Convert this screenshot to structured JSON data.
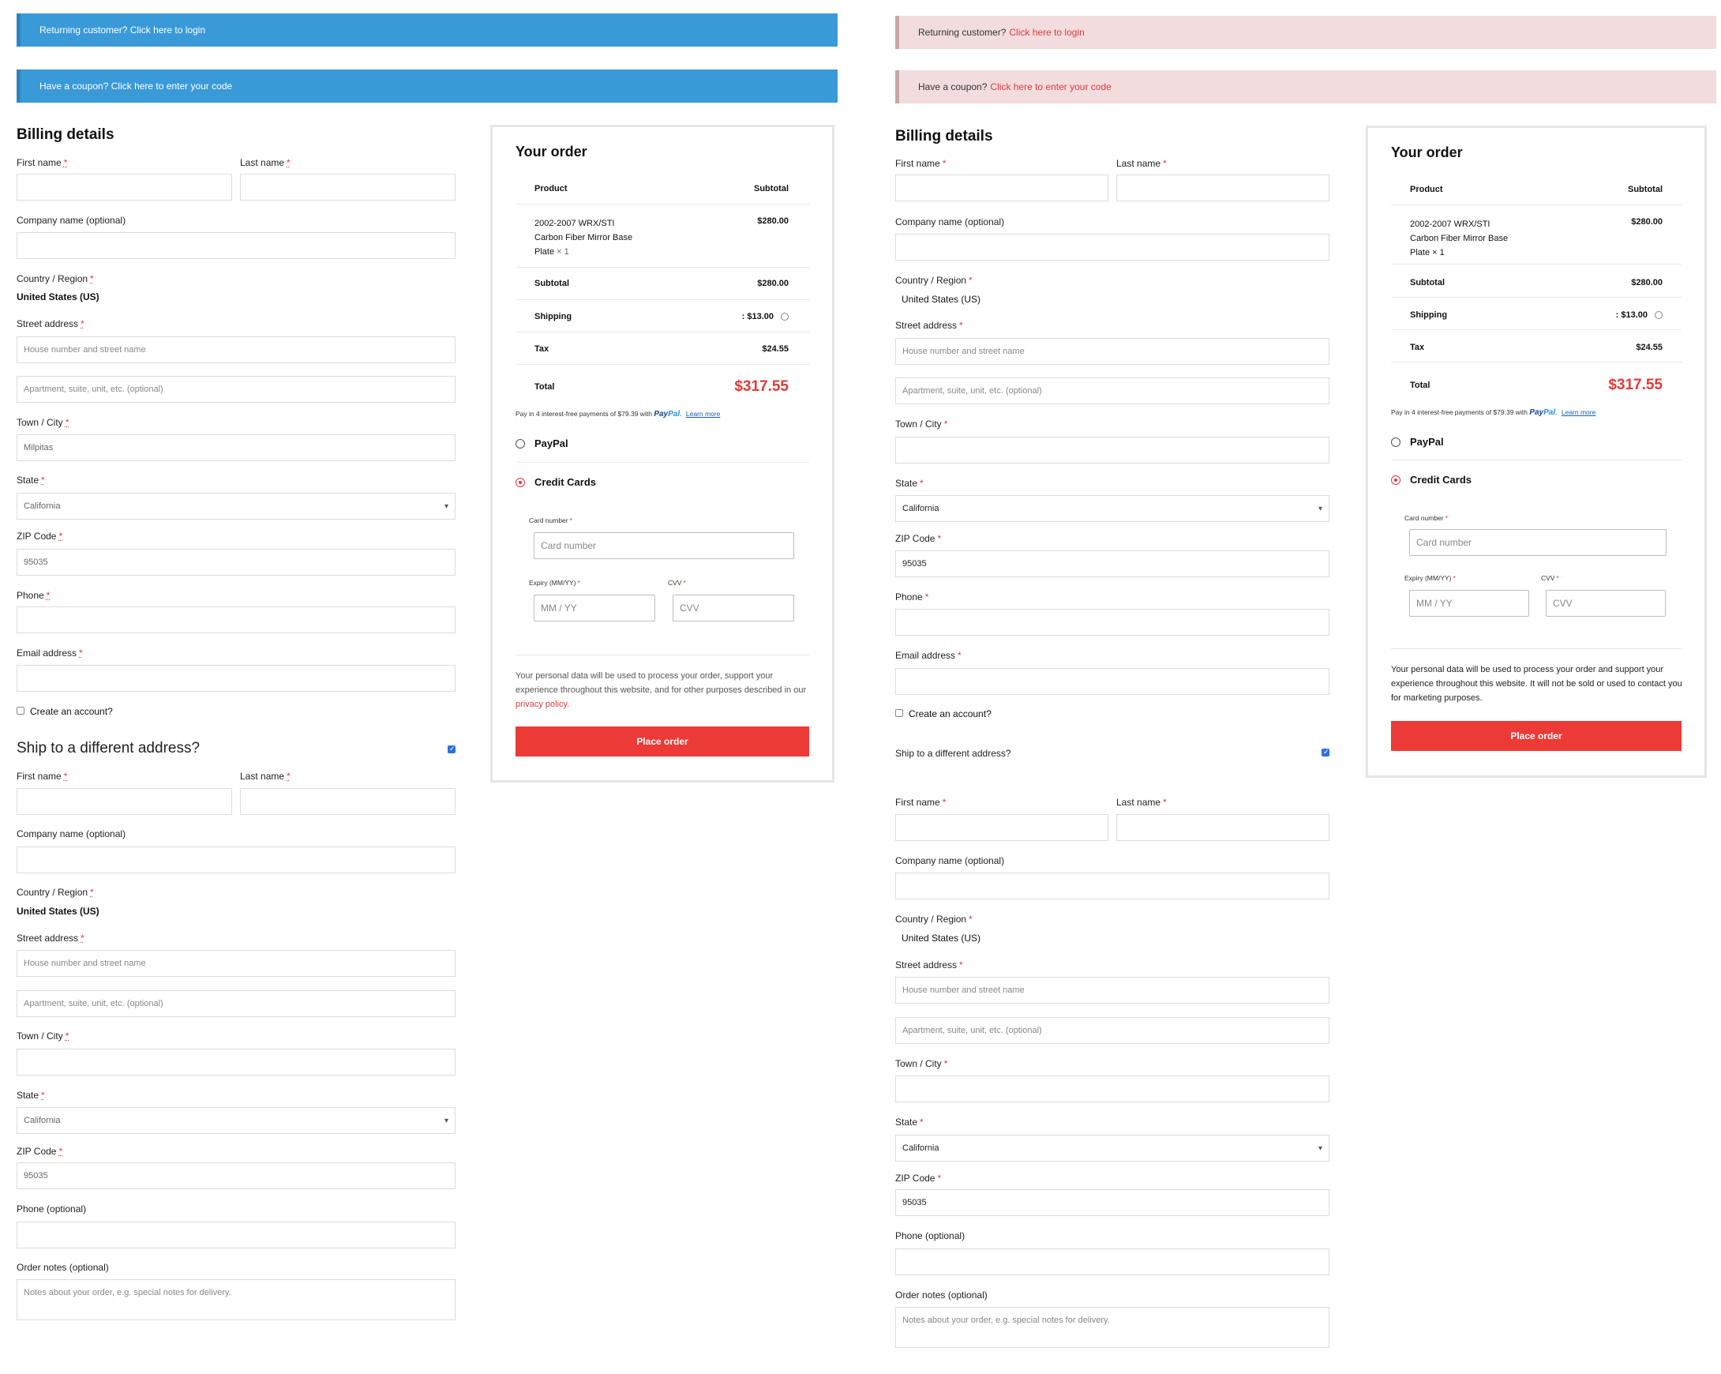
{
  "notices": {
    "returning": {
      "text": "Returning customer?",
      "link": "Click here to login"
    },
    "coupon": {
      "text": "Have a coupon?",
      "link": "Click here to enter your code"
    }
  },
  "billing": {
    "title": "Billing details",
    "first_name": "First name",
    "last_name": "Last name",
    "company": "Company name (optional)",
    "country": "Country / Region",
    "country_value": "United States (US)",
    "street": "Street address",
    "street_placeholder": "House number and street name",
    "apt_placeholder": "Apartment, suite, unit, etc. (optional)",
    "city": "Town / City",
    "city_value": "Milpitas",
    "state": "State",
    "state_value": "California",
    "zip": "ZIP Code",
    "zip_value": "95035",
    "phone": "Phone",
    "email": "Email address",
    "create_account": "Create an account?",
    "req": "*"
  },
  "shipping": {
    "title": "Ship to a different address?",
    "phone": "Phone (optional)",
    "order_notes": "Order notes (optional)",
    "notes_placeholder": "Notes about your order, e.g. special notes for delivery."
  },
  "order": {
    "title": "Your order",
    "col_product": "Product",
    "col_subtotal": "Subtotal",
    "item_line1": "2002-2007 WRX/STI",
    "item_line2": "Carbon Fiber Mirror Base",
    "item_line3": "Plate",
    "item_qty": "× 1",
    "item_price": "$280.00",
    "subtotal_label": "Subtotal",
    "subtotal_value": "$280.00",
    "shipping_label": "Shipping",
    "shipping_value": ": $13.00",
    "tax_label": "Tax",
    "tax_value": "$24.55",
    "total_label": "Total",
    "total_value": "$317.55",
    "paypal_text": "Pay in 4 interest-free payments of $79.39 with",
    "paypal_logo_a": "Pay",
    "paypal_logo_b": "Pal",
    "learn_more": "Learn more",
    "method_paypal": "PayPal",
    "method_cards": "Credit Cards",
    "card_number_label": "Card number",
    "card_number_placeholder": "Card number",
    "expiry_label": "Expiry (MM/YY)",
    "expiry_placeholder": "MM / YY",
    "cvv_label": "CVV",
    "cvv_placeholder": "CVV",
    "privacy_left": "Your personal data will be used to process your order, support your experience throughout this website, and for other purposes described in our",
    "privacy_link": "privacy policy.",
    "privacy_right": "Your personal data will be used to process your order and support your experience throughout this website. It will not be sold or used to contact you for marketing purposes.",
    "place_order": "Place order"
  },
  "colors": {
    "accent_red": "#ec3a37",
    "notice_blue": "#3a9ad7",
    "notice_pink": "#f2dcdd"
  }
}
